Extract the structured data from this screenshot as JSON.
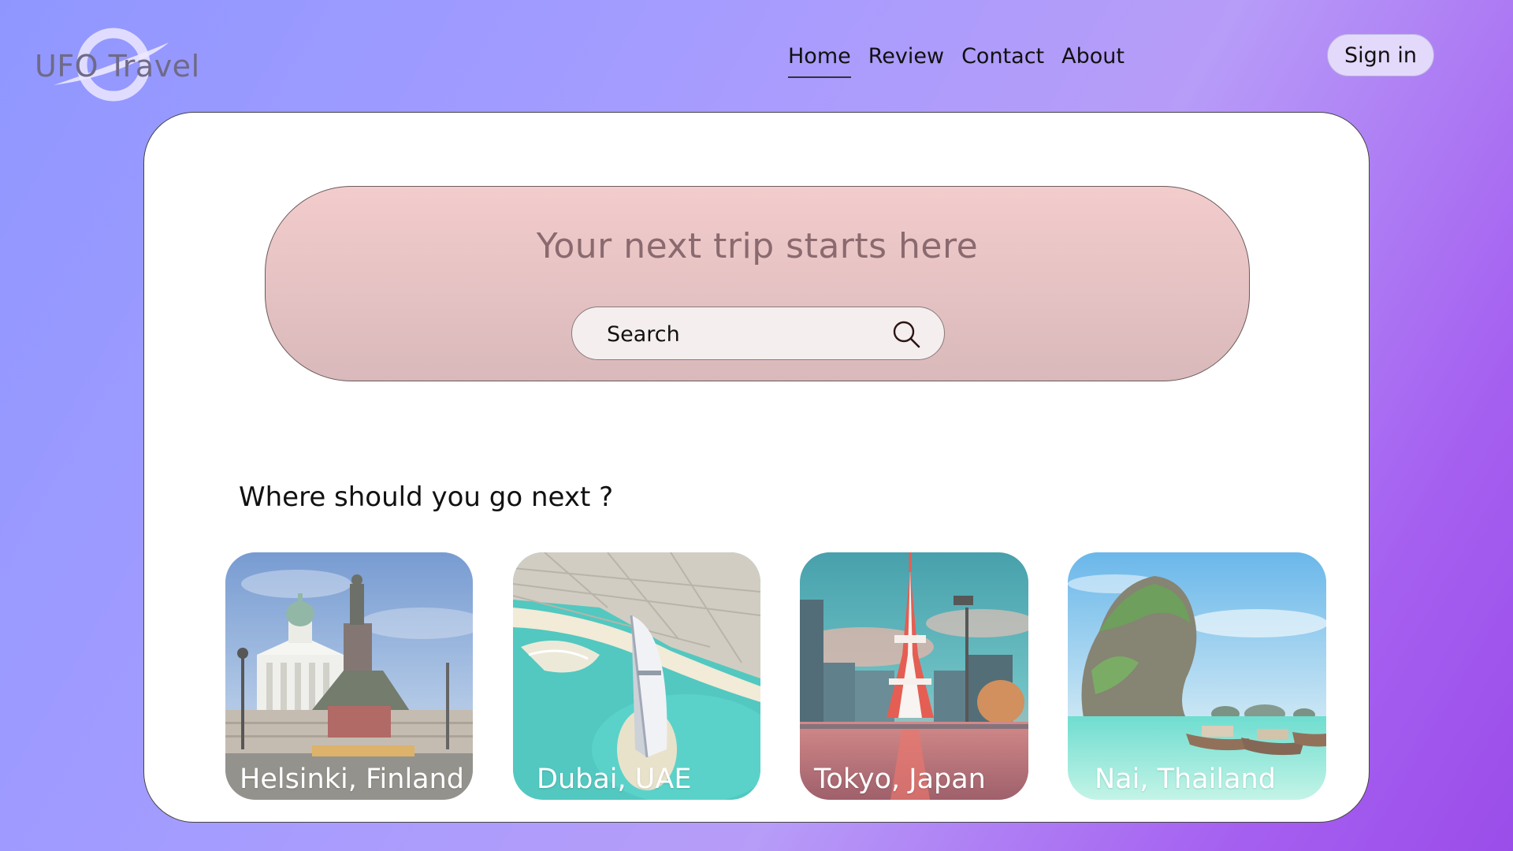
{
  "header": {
    "logo_text": "UFO Travel",
    "nav": [
      {
        "label": "Home",
        "active": true
      },
      {
        "label": "Review",
        "active": false
      },
      {
        "label": "Contact",
        "active": false
      },
      {
        "label": "About",
        "active": false
      }
    ],
    "signin_label": "Sign in"
  },
  "hero": {
    "title": "Your next trip starts here",
    "search_placeholder": "Search",
    "search_icon": "search-icon"
  },
  "section": {
    "title": "Where should you go next ?"
  },
  "destinations": [
    {
      "label": "Helsinki, Finland",
      "image": "helsinki-cathedral-photo"
    },
    {
      "label": "Dubai, UAE",
      "image": "dubai-burj-al-arab-aerial-photo"
    },
    {
      "label": "Tokyo, Japan",
      "image": "tokyo-tower-photo"
    },
    {
      "label": "Nai, Thailand",
      "image": "thailand-limestone-island-boats-photo"
    }
  ],
  "colors": {
    "background_start": "#8f97ff",
    "background_end": "#9b4de9",
    "hero_top": "#f3cccc",
    "hero_bottom": "#d9b9bb",
    "signin_bg": "#e3d9fa"
  }
}
